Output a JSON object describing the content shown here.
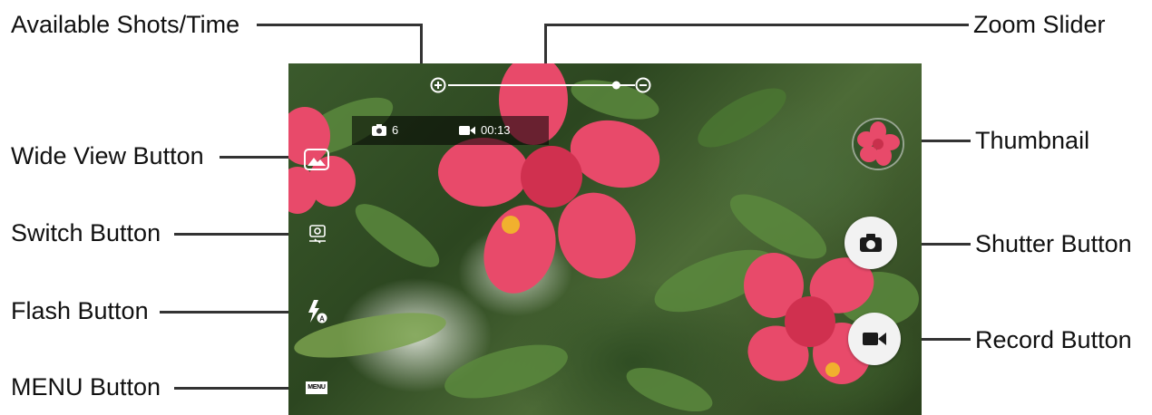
{
  "callouts": {
    "available_shots_time": "Available Shots/Time",
    "zoom_slider": "Zoom Slider",
    "thumbnail": "Thumbnail",
    "wide_view_button": "Wide View Button",
    "shutter_button": "Shutter Button",
    "switch_button": "Switch Button",
    "flash_button": "Flash Button",
    "record_button": "Record Button",
    "menu_button": "MENU Button"
  },
  "camera": {
    "shots_remaining": "6",
    "record_time": "00:13",
    "menu_label": "MENU",
    "zoom_level": 0.9
  },
  "icons": {
    "zoom_in": "plus-circle-icon",
    "zoom_out": "minus-circle-icon",
    "photo": "camera-icon",
    "video": "video-camera-icon",
    "wide_view": "landscape-icon",
    "switch": "switch-camera-icon",
    "flash": "flash-auto-icon"
  },
  "colors": {
    "leader": "#333333",
    "overlay_button": "#f2f2f2",
    "hibiscus": "#e84a6a"
  }
}
